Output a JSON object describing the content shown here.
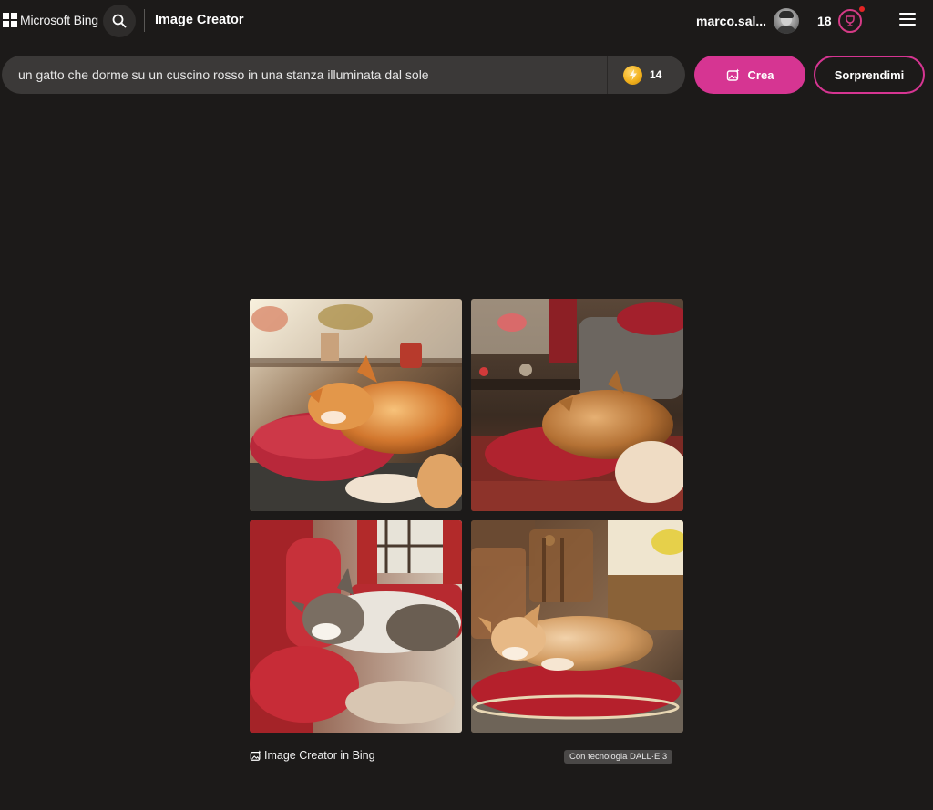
{
  "header": {
    "brand": "Microsoft Bing",
    "app_title": "Image Creator",
    "username": "marco.sal...",
    "rewards_count": "18",
    "icons": {
      "logo": "microsoft-logo-icon",
      "search": "search-icon",
      "rewards": "trophy-icon",
      "menu": "hamburger-menu-icon"
    }
  },
  "prompt": {
    "value": "un gatto che dorme su un cuscino rosso in una stanza illuminata dal sole",
    "boosts": "14"
  },
  "actions": {
    "create_label": "Crea",
    "surprise_label": "Sorprendimi"
  },
  "footer": {
    "brand_label": "Image Creator in Bing",
    "powered_by": "Con tecnologia DALL·E 3"
  },
  "colors": {
    "background": "#1c1a19",
    "accent": "#d63592",
    "prompt_bar": "#3b3938",
    "coin": "#f2b21e"
  }
}
